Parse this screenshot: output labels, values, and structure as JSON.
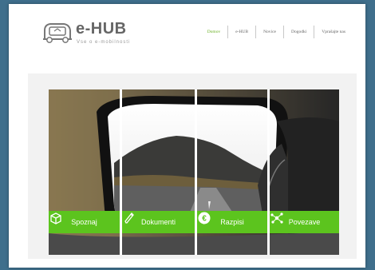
{
  "header": {
    "logo": {
      "title": "e-HUB",
      "tagline": "Vse o e-mobilnosti"
    },
    "nav": [
      "Domov",
      "e-HUB",
      "Novice",
      "Dogodki",
      "Vprašajte nas"
    ],
    "active_nav": "Domov"
  },
  "hero": {
    "tiles": [
      {
        "label": "Spoznaj",
        "icon": "box-icon"
      },
      {
        "label": "Dokumenti",
        "icon": "pencil-icon"
      },
      {
        "label": "Razpisi",
        "icon": "euro-icon"
      },
      {
        "label": "Povezave",
        "icon": "network-icon"
      }
    ]
  },
  "colors": {
    "accent": "#5cc41e",
    "background": "#3f6f8c",
    "nav_active": "#6ab023"
  }
}
